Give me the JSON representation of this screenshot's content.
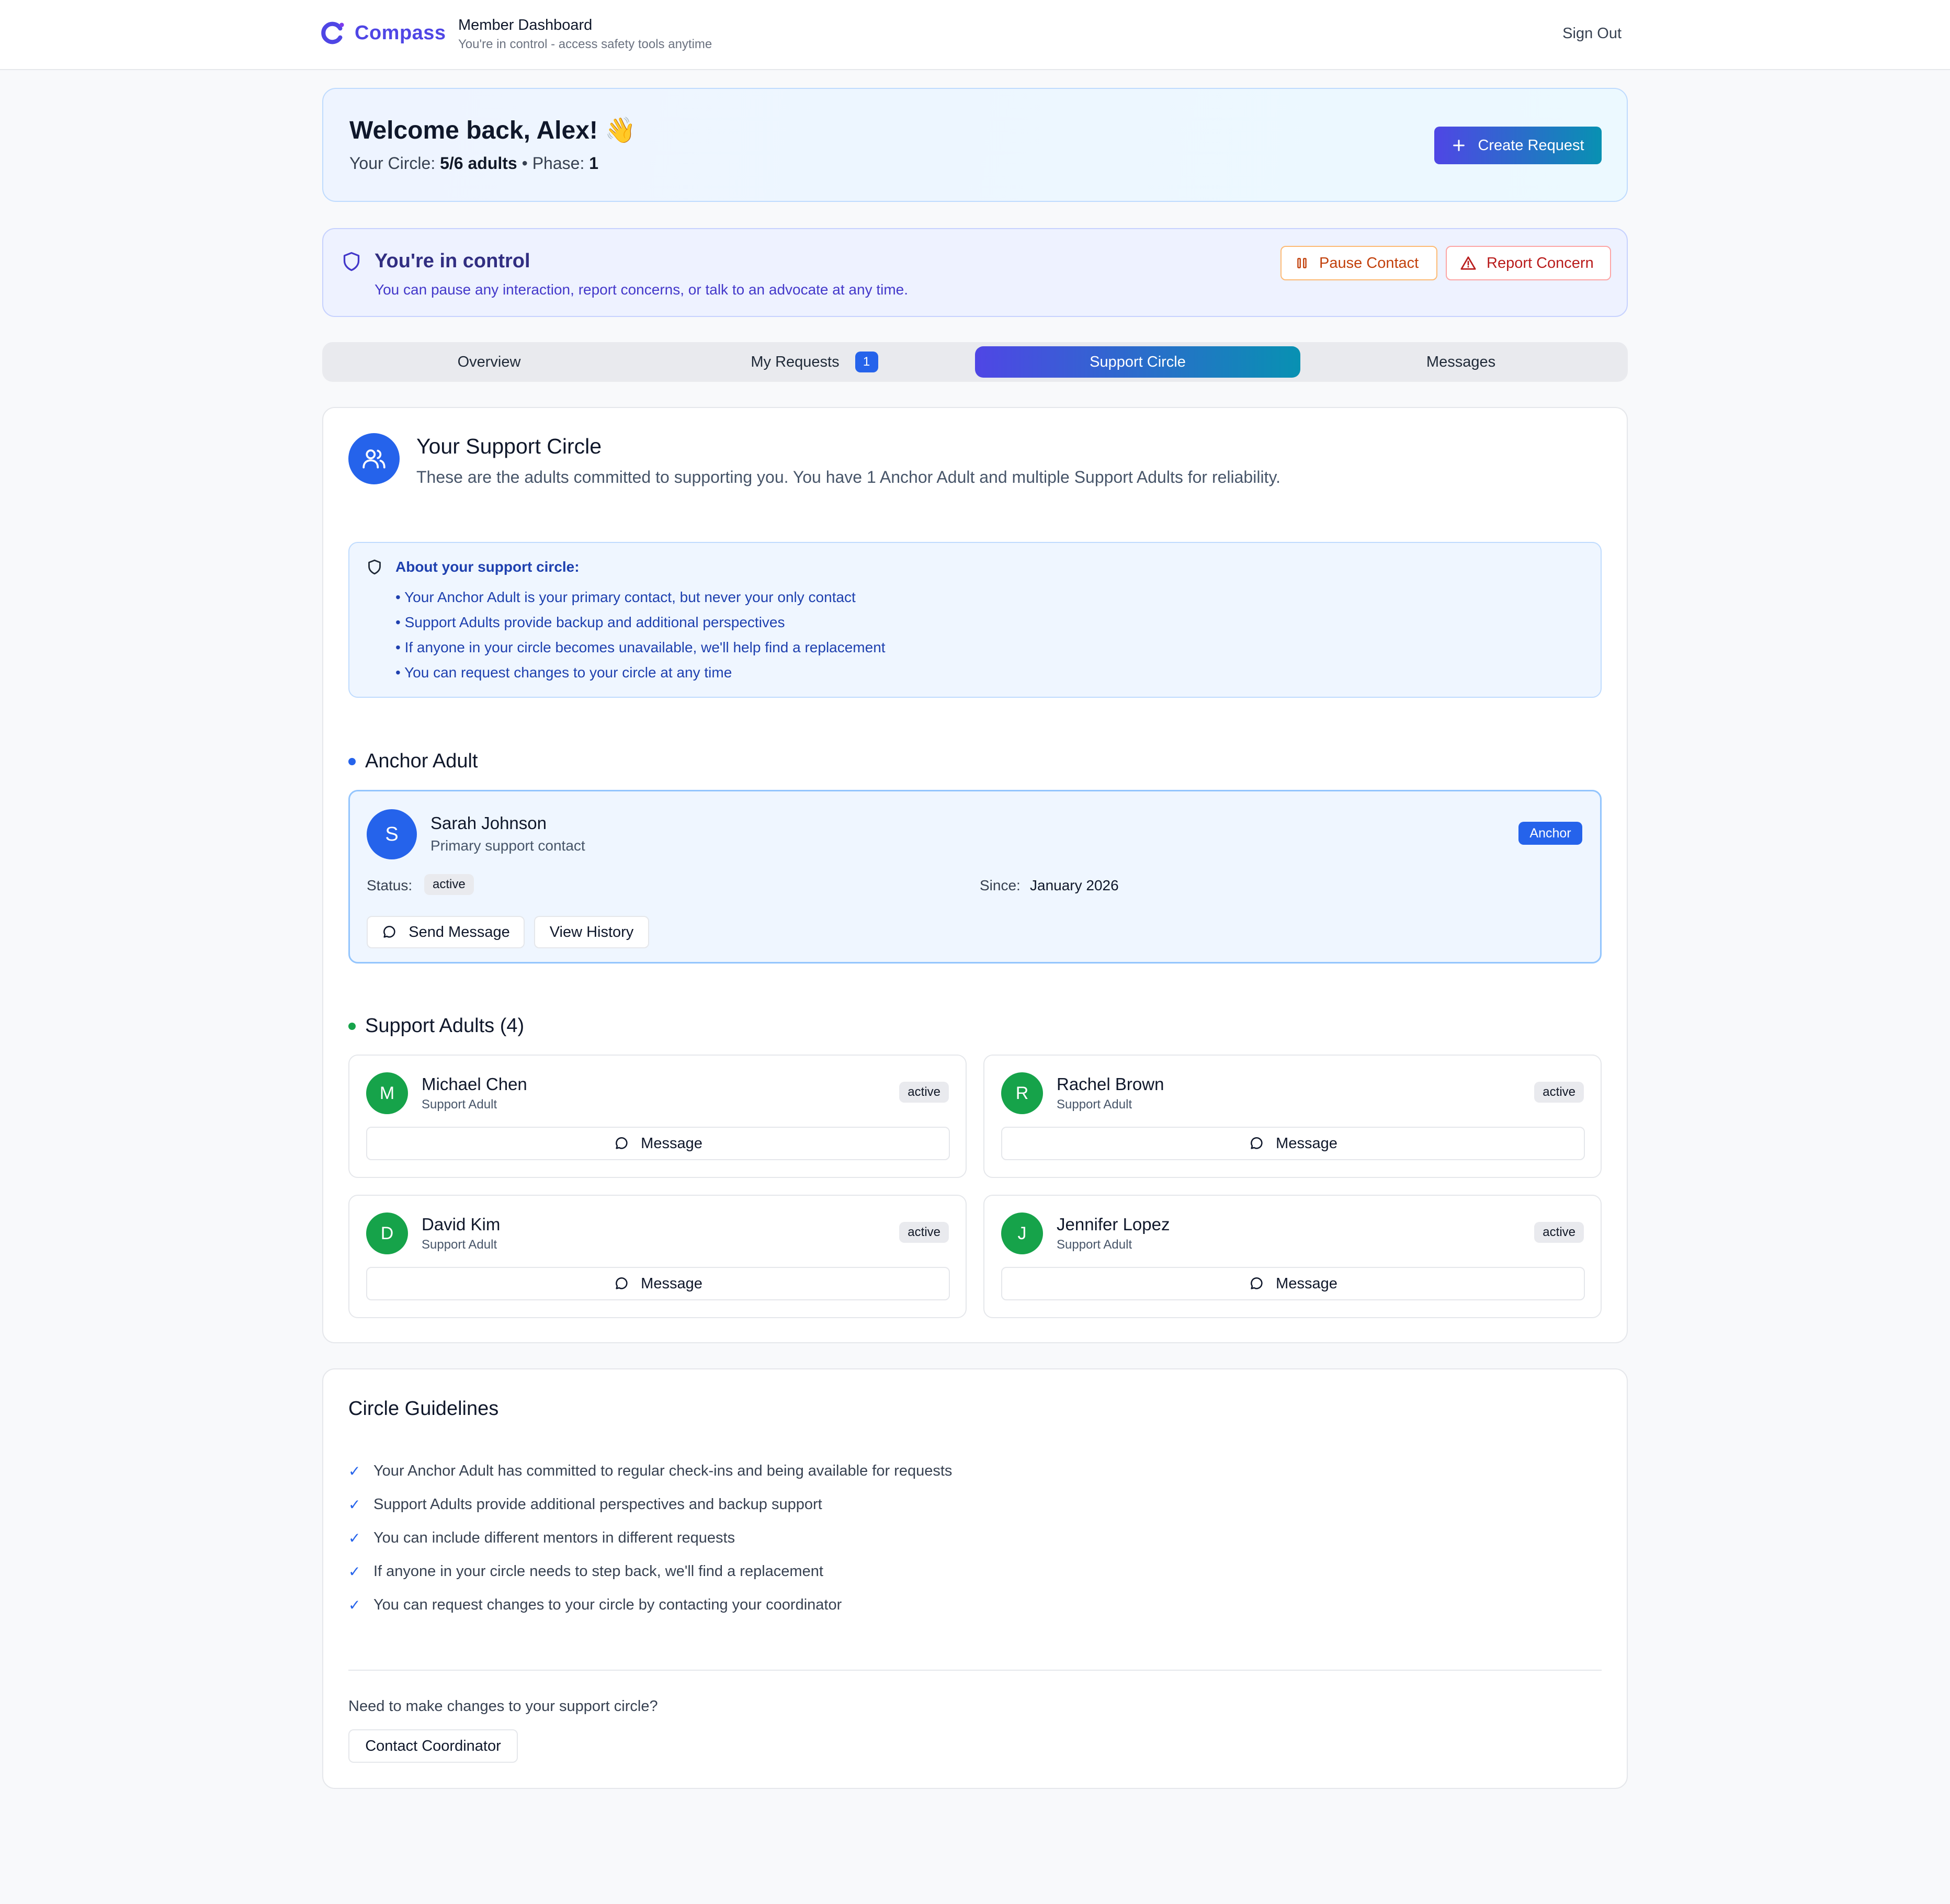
{
  "header": {
    "brand": "Compass",
    "title": "Member Dashboard",
    "subtitle": "You're in control - access safety tools anytime",
    "sign_out": "Sign Out"
  },
  "welcome": {
    "title": "Welcome back, Alex! 👋",
    "circle_label": "Your Circle:",
    "circle_value": "5/6 adults",
    "separator": "•",
    "phase_label": "Phase:",
    "phase_value": "1",
    "create_button": "Create Request"
  },
  "control": {
    "title": "You're in control",
    "subtitle": "You can pause any interaction, report concerns, or talk to an advocate at any time.",
    "pause_button": "Pause Contact",
    "report_button": "Report Concern"
  },
  "tabs": [
    {
      "label": "Overview",
      "badge": null
    },
    {
      "label": "My Requests",
      "badge": "1"
    },
    {
      "label": "Support Circle",
      "badge": null,
      "active": true
    },
    {
      "label": "Messages",
      "badge": null
    }
  ],
  "support_circle": {
    "title": "Your Support Circle",
    "description": "These are the adults committed to supporting you. You have 1 Anchor Adult and multiple Support Adults for reliability.",
    "about": {
      "title": "About your support circle:",
      "items": [
        "• Your Anchor Adult is your primary contact, but never your only contact",
        "• Support Adults provide backup and additional perspectives",
        "• If anyone in your circle becomes unavailable, we'll help find a replacement",
        "• You can request changes to your circle at any time"
      ]
    },
    "anchor_section_title": "Anchor Adult",
    "anchor": {
      "initial": "S",
      "name": "Sarah Johnson",
      "role": "Primary support contact",
      "badge": "Anchor",
      "status_label": "Status:",
      "status": "active",
      "since_label": "Since:",
      "since": "January 2026",
      "send_message": "Send Message",
      "view_history": "View History"
    },
    "support_section_title": "Support Adults (4)",
    "support_adults": [
      {
        "initial": "M",
        "name": "Michael Chen",
        "role": "Support Adult",
        "status": "active",
        "message": "Message"
      },
      {
        "initial": "R",
        "name": "Rachel Brown",
        "role": "Support Adult",
        "status": "active",
        "message": "Message"
      },
      {
        "initial": "D",
        "name": "David Kim",
        "role": "Support Adult",
        "status": "active",
        "message": "Message"
      },
      {
        "initial": "J",
        "name": "Jennifer Lopez",
        "role": "Support Adult",
        "status": "active",
        "message": "Message"
      }
    ]
  },
  "guidelines": {
    "title": "Circle Guidelines",
    "items": [
      "Your Anchor Adult has committed to regular check-ins and being available for requests",
      "Support Adults provide additional perspectives and backup support",
      "You can include different mentors in different requests",
      "If anyone in your circle needs to step back, we'll find a replacement",
      "You can request changes to your circle by contacting your coordinator"
    ],
    "question": "Need to make changes to your support circle?",
    "contact_button": "Contact Coordinator"
  },
  "colors": {
    "brand": "#4f46e5",
    "accent_gradient_start": "#4f46e5",
    "accent_gradient_end": "#0891b2",
    "anchor_blue": "#2563eb",
    "support_green": "#16a34a",
    "pause_orange": "#c2410c",
    "report_red": "#b91c1c"
  }
}
